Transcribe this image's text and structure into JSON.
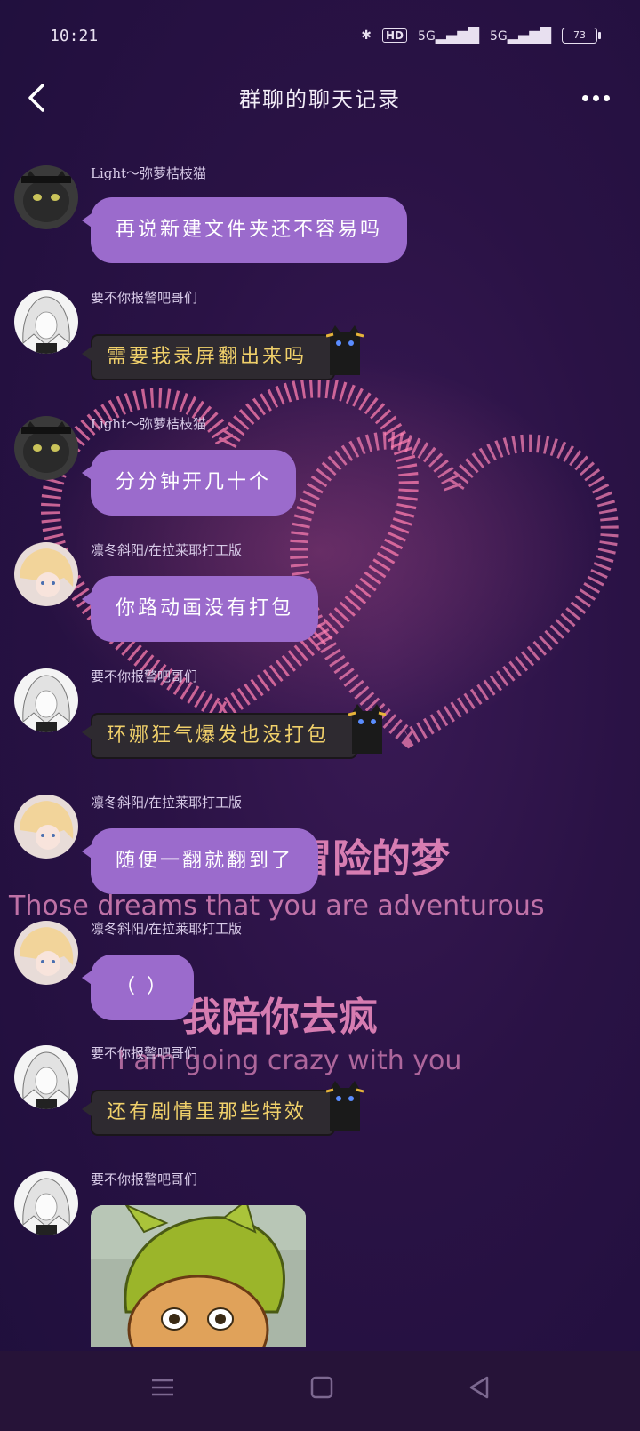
{
  "status_bar": {
    "time": "10:21",
    "hd_label": "HD",
    "signal1": "5G",
    "signal2": "5G",
    "battery": "73"
  },
  "header": {
    "title": "群聊的聊天记录"
  },
  "background_text": {
    "line1_cn": "冒险的梦",
    "line1_en": "Those dreams that you are adventurous",
    "line2_cn": "我陪你去疯",
    "line2_en": "I am going crazy with you"
  },
  "messages": [
    {
      "sender": "Light～弥萝桔枝猫",
      "text": "再说新建文件夹还不容易吗",
      "style": "purple",
      "avatar": "cat"
    },
    {
      "sender": "要不你报警吧哥们",
      "text": "需要我录屏翻出来吗",
      "style": "dark",
      "avatar": "white-hair"
    },
    {
      "sender": "Light～弥萝桔枝猫",
      "text": "分分钟开几十个",
      "style": "purple",
      "avatar": "cat"
    },
    {
      "sender": "凛冬斜阳/在拉莱耶打工版",
      "text": "你路动画没有打包",
      "style": "purple",
      "avatar": "anime-blonde"
    },
    {
      "sender": "要不你报警吧哥们",
      "text": "环娜狂气爆发也没打包",
      "style": "dark",
      "avatar": "white-hair"
    },
    {
      "sender": "凛冬斜阳/在拉莱耶打工版",
      "text": "随便一翻就翻到了",
      "style": "purple",
      "avatar": "anime-blonde"
    },
    {
      "sender": "凛冬斜阳/在拉莱耶打工版",
      "text": "（ ）",
      "style": "purple",
      "avatar": "anime-blonde"
    },
    {
      "sender": "要不你报警吧哥们",
      "text": "还有剧情里那些特效",
      "style": "dark",
      "avatar": "white-hair"
    },
    {
      "sender": "要不你报警吧哥们",
      "text": "",
      "style": "image",
      "avatar": "white-hair"
    }
  ],
  "colors": {
    "bubble_purple": "#9b6bcc",
    "bubble_dark": "#2e2a30",
    "dark_text": "#f0d06a",
    "petal": "#ff7fb0"
  }
}
